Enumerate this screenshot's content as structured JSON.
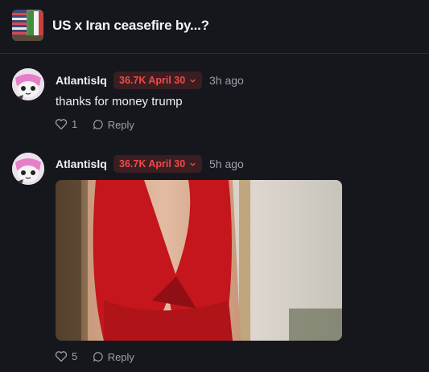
{
  "market": {
    "title": "US x Iran ceasefire by...?",
    "thumbnail": "us-iran-flags-image"
  },
  "comments": [
    {
      "username": "Atlantislq",
      "badge": "36.7K April 30",
      "time": "3h ago",
      "text": "thanks for money trump",
      "likes": "1",
      "reply_label": "Reply"
    },
    {
      "username": "Atlantislq",
      "badge": "36.7K April 30",
      "time": "5h ago",
      "image": "attached-photo",
      "likes": "5",
      "reply_label": "Reply"
    }
  ],
  "colors": {
    "background": "#15171c",
    "badge_text": "#ef4a4a",
    "badge_bg": "#3a1e21",
    "muted": "#9aa0aa"
  }
}
